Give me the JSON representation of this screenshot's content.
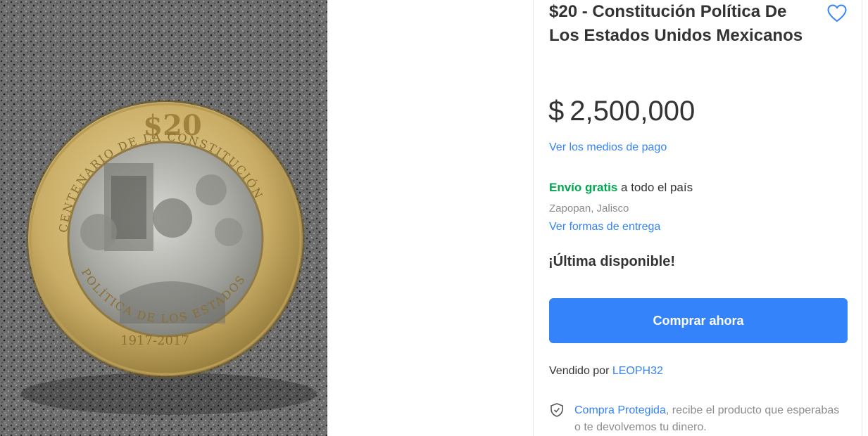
{
  "product": {
    "title": "$20 - Constitución Política De Los Estados Unidos Mexicanos",
    "price": {
      "currency": "$",
      "amount": "2,500,000"
    },
    "payment_link": "Ver los medios de pago",
    "shipping": {
      "free_label": "Envío gratis",
      "suffix": " a todo el país",
      "location": "Zapopan, Jalisco",
      "delivery_link": "Ver formas de entrega"
    },
    "stock": "¡Última disponible!",
    "buy_button": "Comprar ahora",
    "seller": {
      "prefix": "Vendido por ",
      "name": "LEOPH32"
    },
    "protection": {
      "link": "Compra Protegida",
      "text": ", recibe el producto que esperabas o te devolvemos tu dinero."
    }
  },
  "coin_image": {
    "value_text": "$20",
    "years_text": "1917-2017",
    "legend_left": "CENTENARIO DE LA CONSTITUCIÓN",
    "legend_right": "ESTADOS UNIDOS MEXICANOS",
    "legend_bottom": "POLÍTICA DE LOS ESTADOS"
  },
  "colors": {
    "accent": "#3483fa",
    "free_shipping": "#00a650",
    "text_primary": "#333333",
    "text_secondary": "#8c8c8c"
  },
  "icons": {
    "favorite": "heart-outline-icon",
    "protection": "shield-check-icon"
  }
}
